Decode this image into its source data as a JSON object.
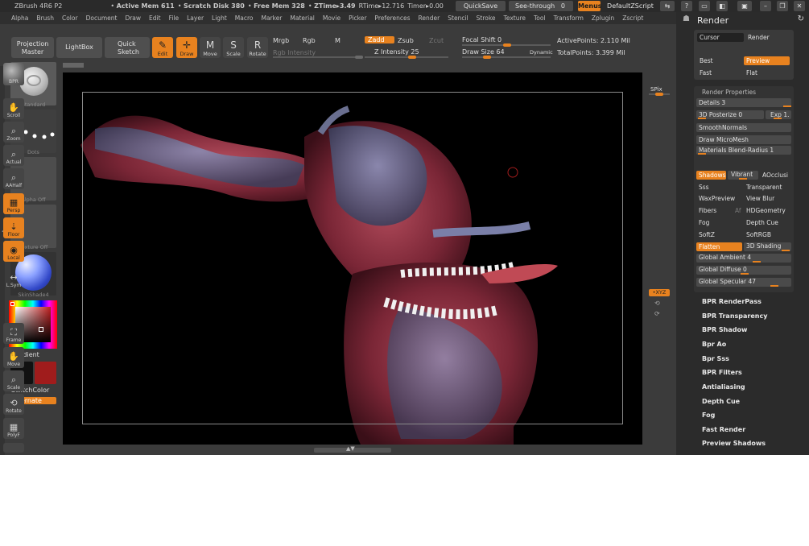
{
  "titlebar": {
    "app": "ZBrush 4R6 P2",
    "active_mem": "Active Mem 611",
    "scratch": "Scratch Disk 380",
    "free_mem": "Free Mem 328",
    "ztime": "ZTime▸3.49",
    "rtime": "RTime▸12.716",
    "timer": "Timer▸0.00",
    "quicksave": "QuickSave",
    "seethrough": "See-through",
    "seethrough_val": "0",
    "menus": "Menus",
    "script": "DefaultZScript"
  },
  "menu": [
    "Alpha",
    "Brush",
    "Color",
    "Document",
    "Draw",
    "Edit",
    "File",
    "Layer",
    "Light",
    "Macro",
    "Marker",
    "Material",
    "Movie",
    "Picker",
    "Preferences",
    "Render",
    "Stencil",
    "Stroke",
    "Texture",
    "Tool",
    "Transform",
    "Zplugin",
    "Zscript"
  ],
  "shelf": {
    "projection": "Projection Master",
    "lightbox": "LightBox",
    "quick_sketch": "Quick Sketch",
    "edit": "Edit",
    "draw": "Draw",
    "move": "Move",
    "scale": "Scale",
    "rotate": "Rotate",
    "mrgb": "Mrgb",
    "rgb": "Rgb",
    "m": "M",
    "rgb_intensity": "Rgb Intensity",
    "zadd": "Zadd",
    "zsub": "Zsub",
    "zcut": "Zcut",
    "z_intensity": "Z Intensity",
    "z_intensity_val": "25",
    "focal_shift": "Focal Shift",
    "focal_shift_val": "0",
    "draw_size": "Draw Size",
    "draw_size_val": "64",
    "dynamic": "Dynamic",
    "active_points": "ActivePoints: 2.110  Mil",
    "total_points": "TotalPoints: 3.399  Mil"
  },
  "left": {
    "standard": "Standard",
    "dots": "Dots",
    "alpha_off": "Alpha  Off",
    "texture_off": "Texture  Off",
    "material": "SkinShade4",
    "gradient": "Gradient",
    "switchcolor": "SwitchColor",
    "alternate": "Alternate",
    "main_color": "#111111",
    "secondary_color": "#a01c1c"
  },
  "right_tray": [
    "BPR",
    "SPix",
    "Scroll",
    "Zoom",
    "Actual",
    "AAHalf",
    "Persp",
    "Floor",
    "Local",
    "L.Sym",
    "XYZ",
    "Frame",
    "Move",
    "Scale",
    "Rotate",
    "PolyF"
  ],
  "panel": {
    "title": "Render",
    "cursor": "Cursor",
    "render": "Render",
    "best": "Best",
    "preview": "Preview",
    "fast": "Fast",
    "flat": "Flat",
    "props_title": "Render Properties",
    "details": "Details 3",
    "posterize": "3D Posterize 0",
    "exp": "Exp 1.",
    "smooth_normals": "SmoothNormals",
    "draw_micromesh": "Draw MicroMesh",
    "materials_blend": "Materials Blend-Radius 1",
    "shadows": "Shadows",
    "vibrant": "Vibrant",
    "aocclusion": "AOcclusi",
    "sss": "Sss",
    "transparent": "Transparent",
    "waxpreview": "WaxPreview",
    "view_blur": "View Blur",
    "fibers": "Fibers",
    "af": "Af",
    "hdgeometry": "HDGeometry",
    "fog": "Fog",
    "depth_cue": "Depth Cue",
    "softz": "SoftZ",
    "softrgb": "SoftRGB",
    "flatten": "Flatten",
    "shading3d": "3D Shading",
    "global_ambient": "Global Ambient 4",
    "global_diffuse": "Global Diffuse 0",
    "global_specular": "Global Specular 47",
    "sub": [
      "BPR RenderPass",
      "BPR Transparency",
      "BPR Shadow",
      "Bpr Ao",
      "Bpr Sss",
      "BPR Filters",
      "Antialiasing",
      "Depth Cue",
      "Fog",
      "Fast Render",
      "Preview Shadows"
    ]
  },
  "colors": {
    "accent": "#e8821f",
    "bg": "#3b3b3b",
    "canvas": "#000000"
  }
}
